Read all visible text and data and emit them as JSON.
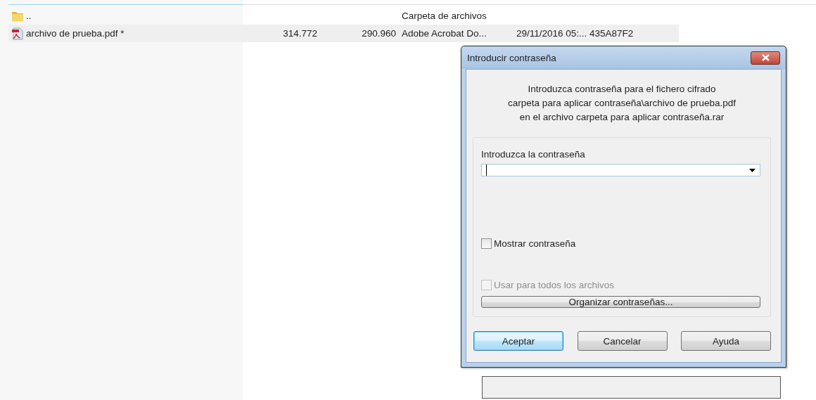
{
  "file_list": {
    "rows": [
      {
        "kind": "folder",
        "selected": false,
        "cells": [
          "..",
          "",
          "",
          "Carpeta de archivos",
          "",
          ""
        ]
      },
      {
        "kind": "pdf",
        "selected": true,
        "cells": [
          "archivo de prueba.pdf *",
          "314.772",
          "290.960",
          "Adobe Acrobat Do...",
          "29/11/2016 05:...",
          "435A87F2"
        ]
      }
    ]
  },
  "dialog": {
    "title": "Introducir contraseña",
    "message": [
      "Introduzca contraseña para el fichero cifrado",
      "carpeta para aplicar contraseña\\archivo de prueba.pdf",
      "en el archivo carpeta para aplicar contraseña.rar"
    ],
    "password_label": "Introduzca la contraseña",
    "checkboxes": [
      {
        "label": "Mostrar contraseña",
        "checked": false,
        "disabled": false
      },
      {
        "label": "Usar para todos los archivos",
        "checked": false,
        "disabled": true
      }
    ],
    "manage_button": "Organizar contraseñas...",
    "buttons": [
      {
        "label": "Aceptar",
        "default": true
      },
      {
        "label": "Cancelar",
        "default": false
      },
      {
        "label": "Ayuda",
        "default": false
      }
    ]
  }
}
